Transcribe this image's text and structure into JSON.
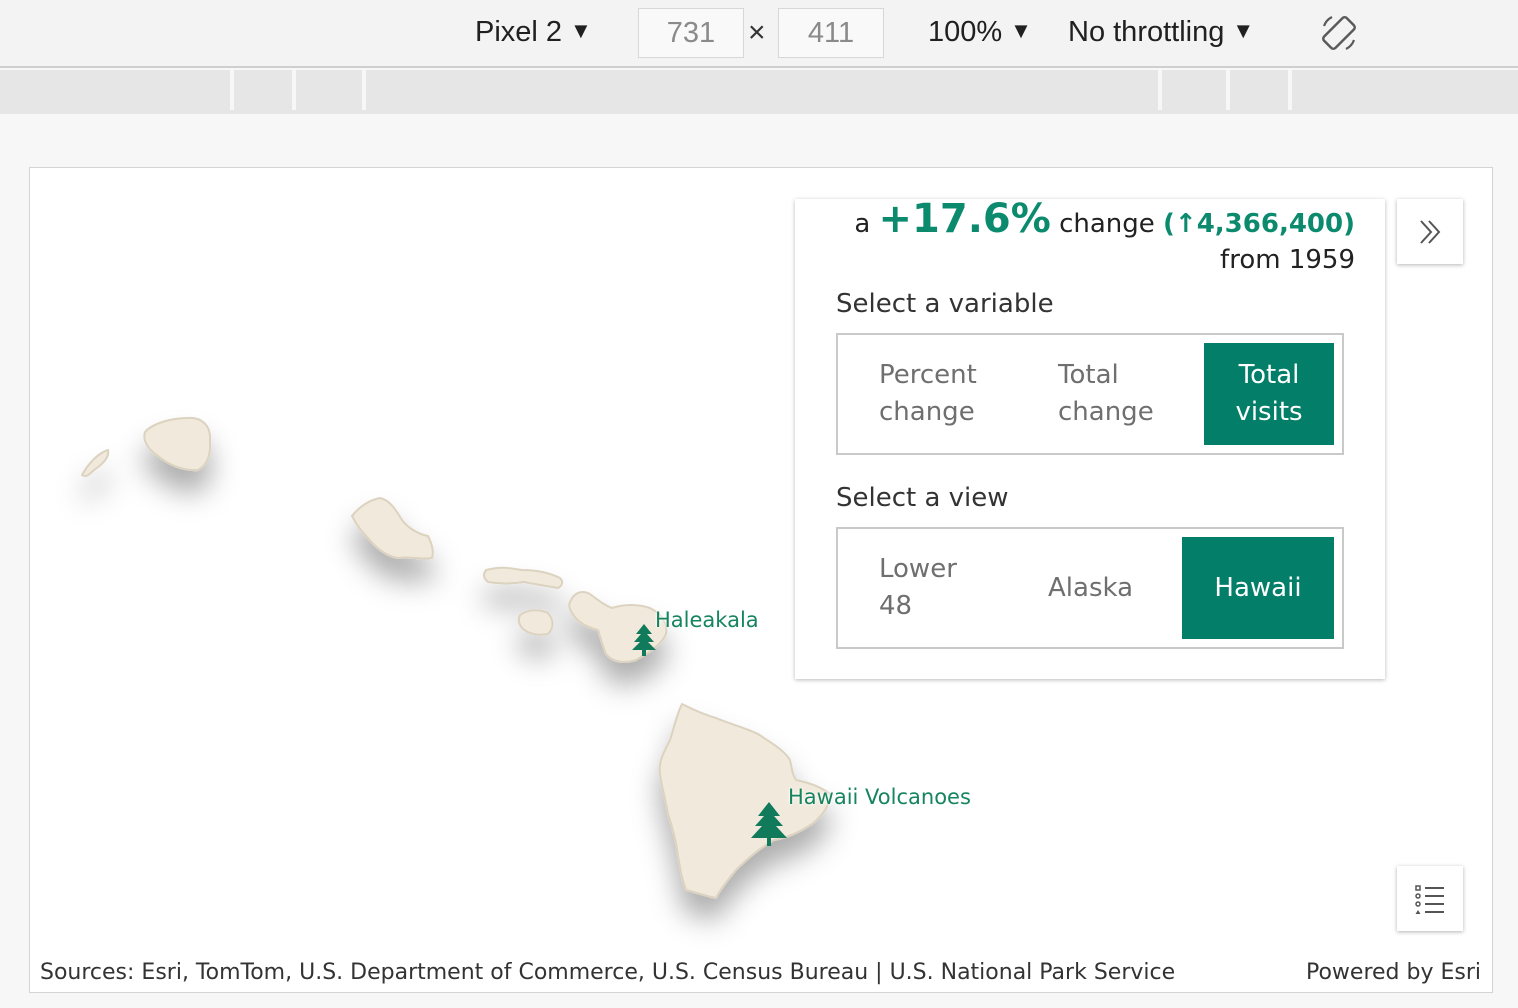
{
  "devtools": {
    "device": "Pixel 2",
    "width": "731",
    "height": "411",
    "dim_separator": "×",
    "zoom": "100%",
    "throttling": "No throttling",
    "caret": "▼"
  },
  "headline": {
    "prefix": "a",
    "percent": "+17.6%",
    "middle": "change",
    "change_value": "(↑4,366,400)",
    "suffix": "from 1959"
  },
  "variable": {
    "label": "Select a variable",
    "options": [
      "Percent change",
      "Total change",
      "Total visits"
    ],
    "selected": "Total visits"
  },
  "view": {
    "label": "Select a view",
    "options": [
      "Lower 48",
      "Alaska",
      "Hawaii"
    ],
    "selected": "Hawaii"
  },
  "parks": [
    {
      "name": "Haleakala"
    },
    {
      "name": "Hawaii Volcanoes"
    }
  ],
  "footer": {
    "attribution": "Sources: Esri, TomTom, U.S. Department of Commerce, U.S. Census Bureau | U.S. National Park Service",
    "powered_by": "Powered by Esri"
  },
  "icons": {
    "collapse": "double-chevron-right-icon",
    "legend": "legend-list-icon",
    "rotate": "rotate-device-icon",
    "park": "tree-icon"
  },
  "colors": {
    "accent": "#037e68",
    "accent_text": "#0c8a6e",
    "land": "#f1e9db",
    "land_stroke": "#dcd2c0"
  }
}
